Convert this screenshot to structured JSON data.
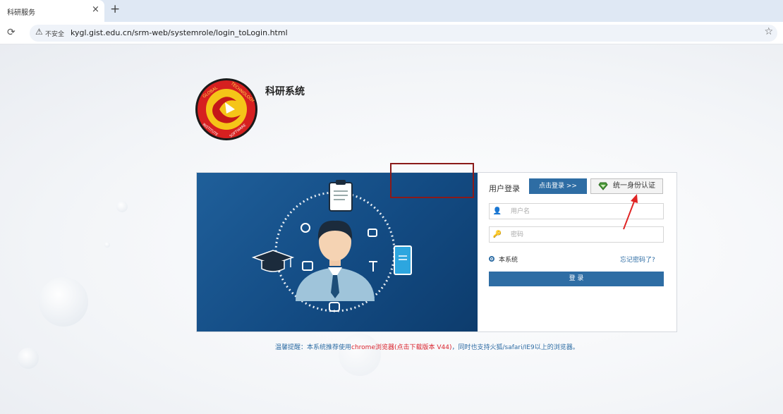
{
  "browser": {
    "tab_title": "科研服务",
    "close_glyph": "×",
    "new_tab_glyph": "+",
    "insecure_label": "不安全",
    "url": "kygl.gist.edu.cn/srm-web/systemrole/login_toLogin.html"
  },
  "header": {
    "system_title": "科研系统",
    "logo_ring_text": [
      "GLOBAL",
      "TECHNOLOGY",
      "INSTITUTE",
      "SOFTWARE"
    ]
  },
  "login": {
    "user_login_label": "用户登录",
    "click_login_button": "点击登录 >>",
    "sso_button": "统一身份认证",
    "username_placeholder": "用户名",
    "password_placeholder": "密码",
    "radio_label": "本系统",
    "forgot_password": "忘记密码了?",
    "login_button": "登 录"
  },
  "notice": {
    "prefix": "温馨提醒：本系统推荐使用",
    "highlight": "chrome浏览器(点击下载版本 V44)",
    "suffix": "，同时也支持火狐/safari/IE9以上的浏览器。"
  },
  "colors": {
    "accent": "#2e6da4",
    "banner": "#134b83",
    "highlight_box": "#8b1a1a",
    "tip_red": "#d9232d"
  },
  "icons": [
    "reload-icon",
    "warning-icon",
    "star-icon",
    "user-icon",
    "key-icon",
    "gem-icon",
    "arrow-annotation"
  ]
}
